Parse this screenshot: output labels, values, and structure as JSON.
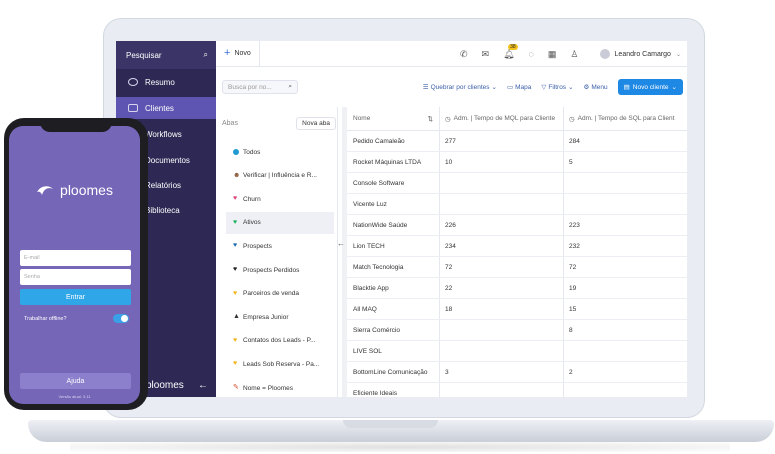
{
  "sidebar": {
    "search_label": "Pesquisar",
    "items": [
      {
        "label": "Resumo"
      },
      {
        "label": "Clientes"
      },
      {
        "label": "Workflows"
      },
      {
        "label": "Documentos"
      },
      {
        "label": "Relatórios"
      },
      {
        "label": "Biblioteca"
      }
    ],
    "brand": "ploomes",
    "collapse_glyph": "←"
  },
  "topbar": {
    "new_label": "Novo",
    "notification_count": "38",
    "user_name": "Leandro Camargo"
  },
  "toolbar": {
    "search_placeholder": "Busca por no...",
    "group_by_label": "Quebrar por clientes",
    "map_label": "Mapa",
    "filters_label": "Filtros",
    "menu_label": "Menu",
    "new_client_label": "Novo cliente"
  },
  "tabs": {
    "title": "Abas",
    "new_tab_label": "Nova aba",
    "items": [
      {
        "label": "Todos",
        "color": "#1f9bd1",
        "shape": "dot"
      },
      {
        "label": "Verificar | Influência e R...",
        "color": "#8a5a3c",
        "shape": "person"
      },
      {
        "label": "Churn",
        "color": "#e0457b",
        "shape": "heart"
      },
      {
        "label": "Ativos",
        "color": "#22b35e",
        "shape": "heart"
      },
      {
        "label": "Prospects",
        "color": "#1f6fb5",
        "shape": "heart"
      },
      {
        "label": "Prospects Perdidos",
        "color": "#222222",
        "shape": "heart"
      },
      {
        "label": "Parceiros de venda",
        "color": "#f2b51f",
        "shape": "heart"
      },
      {
        "label": "Empresa Junior",
        "color": "#333333",
        "shape": "cap"
      },
      {
        "label": "Contatos dos Leads - P...",
        "color": "#f2b51f",
        "shape": "heart"
      },
      {
        "label": "Leads Sob Reserva - Pa...",
        "color": "#f2b51f",
        "shape": "heart"
      },
      {
        "label": "Nome = Ploomes",
        "color": "#d94b2b",
        "shape": "pencil"
      }
    ],
    "selected_index": 3
  },
  "table": {
    "columns": [
      "Nome",
      "Adm. | Tempo de MQL para Cliente",
      "Adm. | Tempo de SQL para Client"
    ],
    "rows": [
      [
        "Pedido Camaleão",
        "277",
        "284"
      ],
      [
        "Rocket Máquinas LTDA",
        "10",
        "5"
      ],
      [
        "Console Software",
        "",
        ""
      ],
      [
        "Vicente Luz",
        "",
        ""
      ],
      [
        "NationWide Saúde",
        "226",
        "223"
      ],
      [
        "Lion TECH",
        "234",
        "232"
      ],
      [
        "Match Tecnologia",
        "72",
        "72"
      ],
      [
        "Blacktie App",
        "22",
        "19"
      ],
      [
        "All MAQ",
        "18",
        "15"
      ],
      [
        "Sierra Comércio",
        "",
        "8"
      ],
      [
        "LIVE SOL",
        "",
        ""
      ],
      [
        "BottomLine Comunicação",
        "3",
        "2"
      ],
      [
        "Eficiente Ideais",
        "",
        ""
      ]
    ]
  },
  "phone": {
    "brand": "ploomes",
    "email_placeholder": "E-mail",
    "password_placeholder": "Senha",
    "login_label": "Entrar",
    "offline_label": "Trabalhar offline?",
    "help_label": "Ajuda",
    "version": "Versão atual: 3.11"
  },
  "colors": {
    "sidebar_bg": "#2d2854",
    "sidebar_active": "#5d55b1",
    "primary": "#1e88e5",
    "phone_bg": "#7566b8",
    "phone_button": "#2fa6e8"
  }
}
